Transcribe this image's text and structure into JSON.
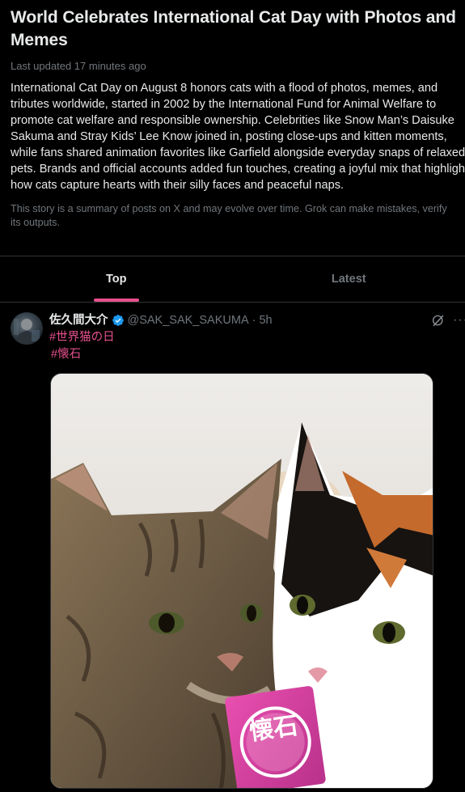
{
  "story": {
    "title": "World Celebrates International Cat Day with Photos and Memes",
    "updated": "Last updated 17 minutes ago",
    "summary": "International Cat Day on August 8 honors cats with a flood of photos, memes, and tributes worldwide, started in 2002 by the International Fund for Animal Welfare to promote cat welfare and responsible ownership. Celebrities like Snow Man’s Daisuke Sakuma and Stray Kids’ Lee Know joined in, posting close-ups and kitten moments, while fans shared animation favorites like Garfield alongside everyday snaps of relaxed pets. Brands and official accounts added fun touches, creating a joyful mix that highlights how cats capture hearts with their silly faces and peaceful naps.",
    "disclaimer": "This story is a summary of posts on X and may evolve over time. Grok can make mistakes, verify its outputs."
  },
  "tabs": [
    {
      "label": "Top",
      "active": true
    },
    {
      "label": "Latest",
      "active": false
    }
  ],
  "post": {
    "author_name": "佐久間大介",
    "handle": "@SAK_SAK_SAKUMA",
    "time": "· 5h",
    "hashtags": [
      "#世界猫の日",
      "#懐石"
    ],
    "media_label": "懐石"
  },
  "colors": {
    "accent": "#e5508c",
    "verified": "#1d9bf0",
    "muted": "#71767b",
    "text": "#e7e9ea",
    "border": "#2f3336"
  }
}
